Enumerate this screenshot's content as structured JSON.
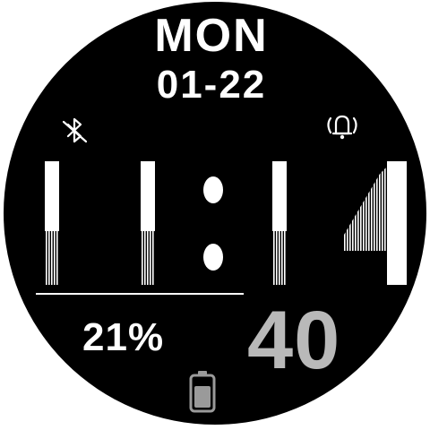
{
  "watchface": {
    "day": "MON",
    "date": "01-22",
    "hours": "11",
    "minutes": "14",
    "separator": ":",
    "seconds": "40",
    "battery_percent": "21%",
    "battery_level": 0.21,
    "status_icons": [
      "bluetooth-off-icon",
      "alarm-icon",
      "battery-icon"
    ],
    "colors": {
      "background": "#000000",
      "primary": "#ffffff",
      "seconds": "#b9b9b9"
    }
  }
}
